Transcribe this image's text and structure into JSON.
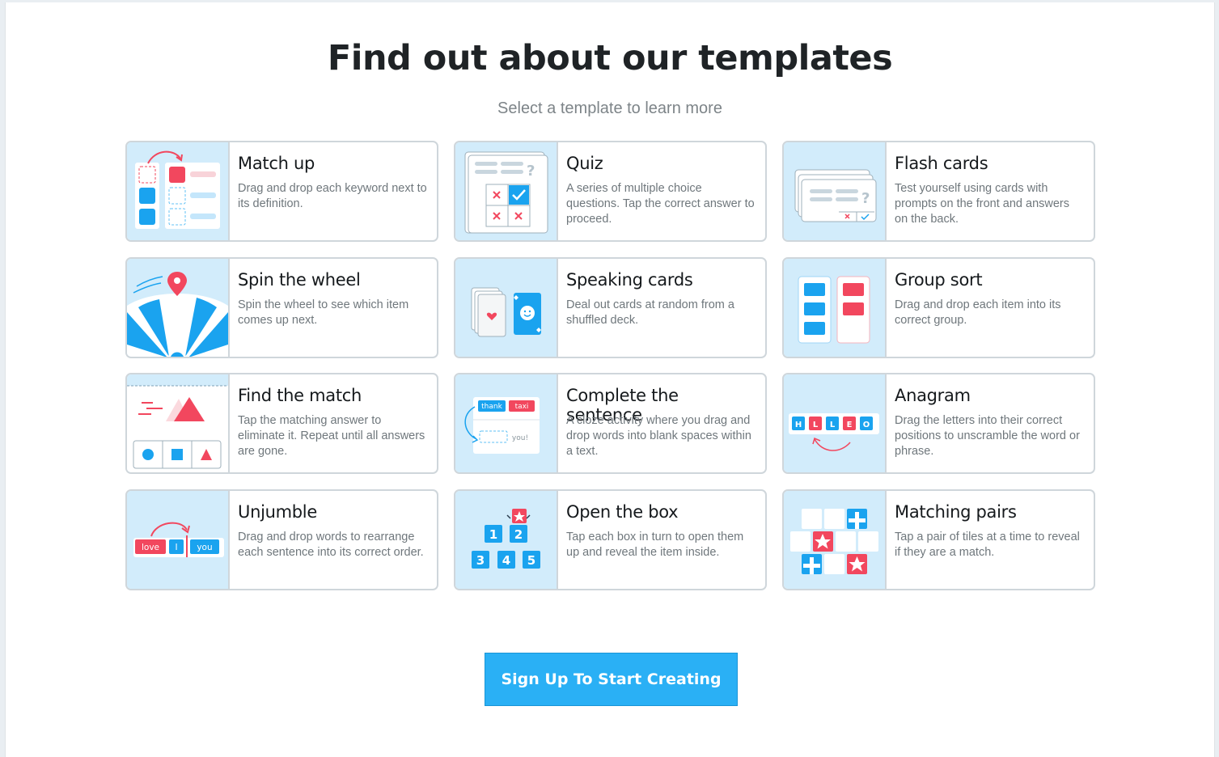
{
  "header": {
    "title": "Find out about our templates",
    "subtitle": "Select a template to learn more"
  },
  "templates": [
    {
      "name": "Match up",
      "description": "Drag and drop each keyword next to its definition.",
      "icon": "match-up-icon"
    },
    {
      "name": "Quiz",
      "description": "A series of multiple choice questions. Tap the correct answer to proceed.",
      "icon": "quiz-icon"
    },
    {
      "name": "Flash cards",
      "description": "Test yourself using cards with prompts on the front and answers on the back.",
      "icon": "flash-cards-icon"
    },
    {
      "name": "Spin the wheel",
      "description": "Spin the wheel to see which item comes up next.",
      "icon": "spin-the-wheel-icon"
    },
    {
      "name": "Speaking cards",
      "description": "Deal out cards at random from a shuffled deck.",
      "icon": "speaking-cards-icon"
    },
    {
      "name": "Group sort",
      "description": "Drag and drop each item into its correct group.",
      "icon": "group-sort-icon"
    },
    {
      "name": "Find the match",
      "description": "Tap the matching answer to eliminate it. Repeat until all answers are gone.",
      "icon": "find-the-match-icon"
    },
    {
      "name": "Complete the sentence",
      "description": "A cloze activity where you drag and drop words into blank spaces within a text.",
      "icon": "complete-the-sentence-icon"
    },
    {
      "name": "Anagram",
      "description": "Drag the letters into their correct positions to unscramble the word or phrase.",
      "icon": "anagram-icon"
    },
    {
      "name": "Unjumble",
      "description": "Drag and drop words to rearrange each sentence into its correct order.",
      "icon": "unjumble-icon"
    },
    {
      "name": "Open the box",
      "description": "Tap each box in turn to open them up and reveal the item inside.",
      "icon": "open-the-box-icon"
    },
    {
      "name": "Matching pairs",
      "description": "Tap a pair of tiles at a time to reveal if they are a match.",
      "icon": "matching-pairs-icon"
    }
  ],
  "illustrations": {
    "complete_sentence_words": [
      "thank",
      "taxi",
      "you!"
    ],
    "anagram_letters": [
      "H",
      "L",
      "L",
      "E",
      "O"
    ],
    "unjumble_words": [
      "love",
      "I",
      "you"
    ],
    "box_numbers": [
      "1",
      "2",
      "3",
      "4",
      "5"
    ]
  },
  "cta": {
    "label": "Sign Up To Start Creating"
  },
  "colors": {
    "accent": "#2ab0f5",
    "red": "#f2475e",
    "thumb_bg": "#d2ecfb",
    "border": "#cfd6db"
  }
}
